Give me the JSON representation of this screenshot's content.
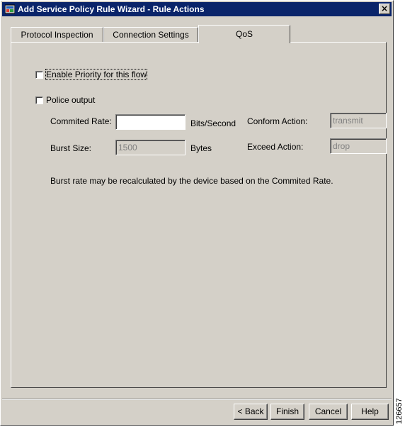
{
  "window": {
    "title": "Add Service Policy Rule Wizard - Rule Actions",
    "close_glyph": "×"
  },
  "tabs": [
    {
      "label": "Protocol Inspection"
    },
    {
      "label": "Connection Settings"
    },
    {
      "label": "QoS"
    }
  ],
  "qos": {
    "enable_priority": {
      "label": "Enable Priority for this flow",
      "checked": false
    },
    "police_output": {
      "label": "Police output",
      "checked": false
    },
    "committed_rate": {
      "label": "Commited Rate:",
      "value": "",
      "unit": "Bits/Second"
    },
    "burst_size": {
      "label": "Burst Size:",
      "value": "1500",
      "unit": "Bytes"
    },
    "conform_action": {
      "label": "Conform Action:",
      "value": "transmit"
    },
    "exceed_action": {
      "label": "Exceed Action:",
      "value": "drop"
    },
    "note": "Burst rate may be recalculated by the device based on the Commited Rate."
  },
  "buttons": {
    "back": "< Back",
    "finish": "Finish",
    "cancel": "Cancel",
    "help": "Help"
  },
  "figure_id": "126657"
}
